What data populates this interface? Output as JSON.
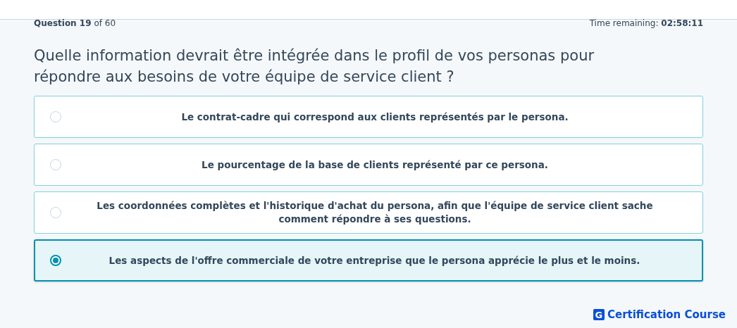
{
  "progress": {
    "label": "Question",
    "number": "19",
    "of": "of 60"
  },
  "timer": {
    "label": "Time remaining:",
    "value": "02:58:11"
  },
  "question": "Quelle information devrait être intégrée dans le profil de vos personas pour répondre aux besoins de votre équipe de service client ?",
  "options": [
    {
      "text": "Le contrat-cadre qui correspond aux clients représentés par le persona.",
      "selected": false
    },
    {
      "text": "Le pourcentage de la base de clients représenté par ce persona.",
      "selected": false
    },
    {
      "text": "Les coordonnées complètes et l'historique d'achat du persona, afin que l'équipe de service client sache comment répondre à ses questions.",
      "selected": false
    },
    {
      "text": "Les aspects de l'offre commerciale de votre entreprise que le persona apprécie le plus et le moins.",
      "selected": true
    }
  ],
  "brand": {
    "logo_letter": "G",
    "name": "Certification Course"
  }
}
